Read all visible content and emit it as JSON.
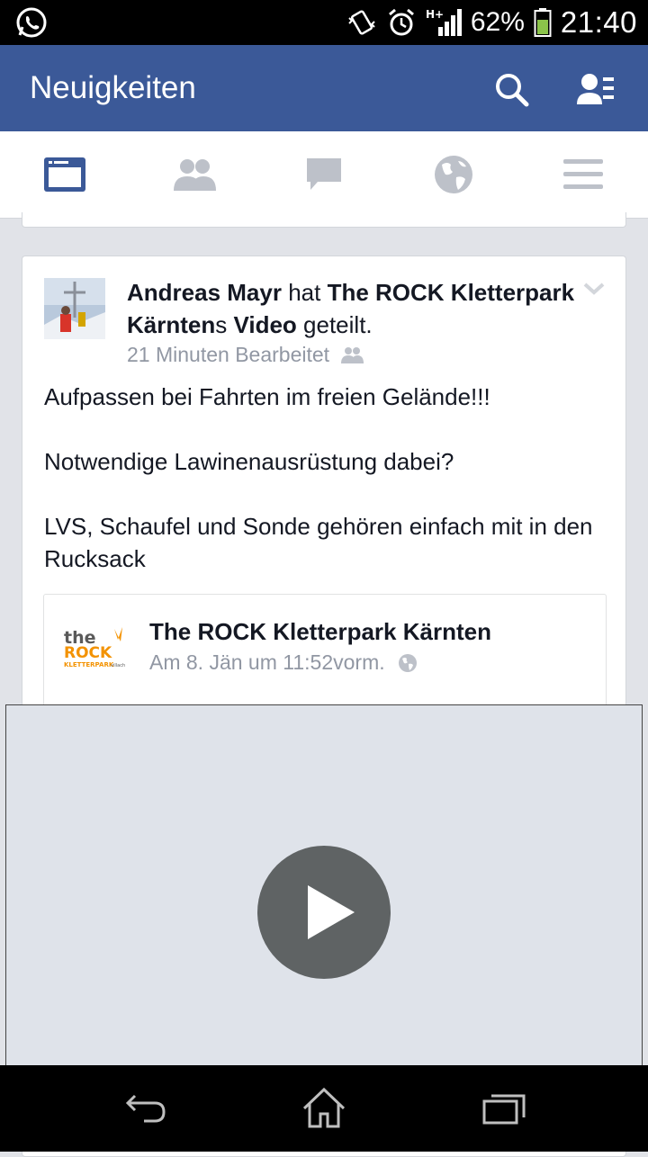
{
  "status_bar": {
    "left_icon": "whatsapp-icon",
    "battery_percent": "62%",
    "time": "21:40",
    "icons": [
      "vibrate-icon",
      "alarm-icon",
      "signal-hplus-icon",
      "battery-icon"
    ]
  },
  "app_bar": {
    "title": "Neuigkeiten",
    "actions": [
      "search-icon",
      "friend-requests-icon"
    ]
  },
  "tabs": [
    "news-feed-tab",
    "friends-tab",
    "messages-tab",
    "notifications-globe-tab",
    "menu-tab"
  ],
  "post": {
    "author": "Andreas Mayr",
    "shared_word": " hat ",
    "page_name_bold": "The ROCK Kletterpark Kärnten",
    "possessive": "s ",
    "video_word": "Video",
    "shared_suffix": " geteilt.",
    "meta": "21 Minuten Bearbeitet",
    "audience_icon": "friends-audience-icon",
    "body": [
      "Aufpassen bei Fahrten im freien Gelände!!!",
      "Notwendige Lawinenausrüstung dabei?",
      "LVS, Schaufel und Sonde gehören einfach mit in den Rucksack"
    ],
    "shared_card": {
      "page_name": "The ROCK Kletterpark Kärnten",
      "timestamp": "Am 8. Jän um 11:52vorm.",
      "privacy_icon": "public-globe-icon",
      "logo_text": "the ROCK",
      "logo_sub": "KLETTERPARK",
      "logo_sub2": "villach"
    }
  },
  "colors": {
    "brand_blue": "#3b5998",
    "tab_active": "#3b5998",
    "tab_inactive": "#bdc1c9",
    "meta_gray": "#9197a3"
  },
  "nav_bar": [
    "back-icon",
    "home-icon",
    "recent-apps-icon"
  ]
}
